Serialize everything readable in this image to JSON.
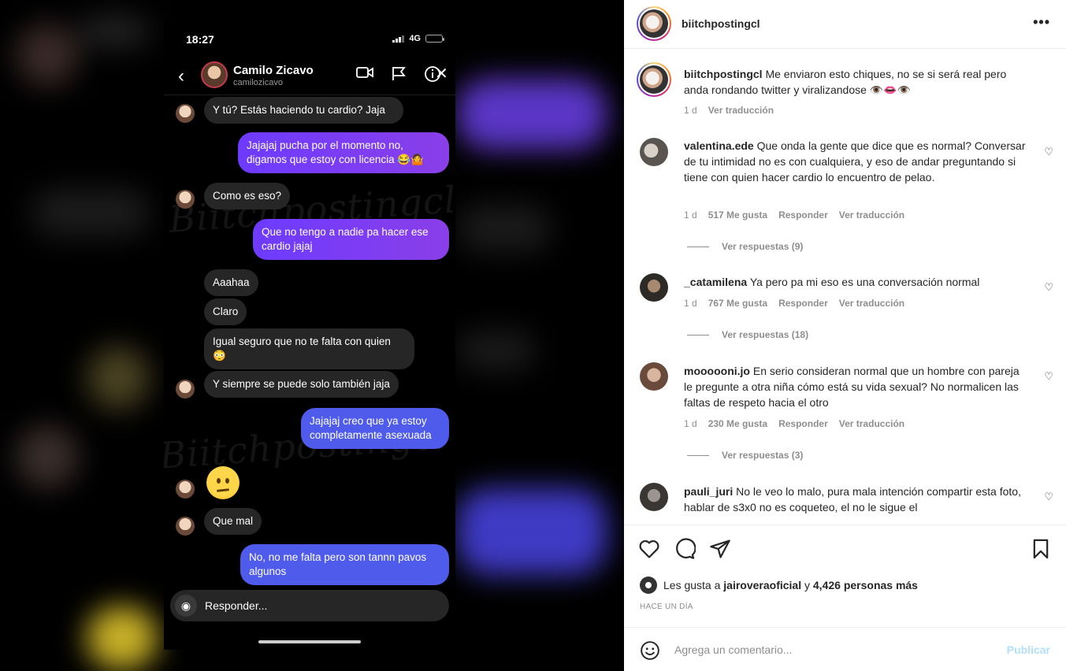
{
  "post": {
    "username": "biitchpostingcl",
    "more_icon": "more-horizontal-icon"
  },
  "screenshot": {
    "status_time": "18:27",
    "network": "4G",
    "contact_name": "Camilo Zicavo",
    "contact_handle": "camilozicavo",
    "watermark": "Biitchpostingcl",
    "messages": [
      {
        "dir": "in",
        "text": "Y tú? Estás haciendo tu cardio? Jaja"
      },
      {
        "dir": "out",
        "text": "Jajajaj pucha por el momento no, digamos que estoy con licencia 😂🤷"
      },
      {
        "dir": "in",
        "text": "Como es eso?"
      },
      {
        "dir": "out",
        "text": "Que no tengo a nadie pa hacer ese cardio jajaj"
      },
      {
        "dir": "in",
        "text": "Aaahaa"
      },
      {
        "dir": "in",
        "text": "Claro"
      },
      {
        "dir": "in",
        "text": "Igual seguro que no te falta con quien 😳"
      },
      {
        "dir": "in",
        "text": "Y siempre se puede solo también jaja"
      },
      {
        "dir": "out",
        "text": "Jajajaj creo que ya estoy completamente asexuada"
      },
      {
        "dir": "in",
        "text": "😕"
      },
      {
        "dir": "in",
        "text": "Que mal"
      },
      {
        "dir": "out",
        "text": "No, no me falta pero son tannn pavos algunos"
      }
    ],
    "composer_placeholder": "Responder..."
  },
  "caption": {
    "username": "biitchpostingcl",
    "text": "Me enviaron esto chiques, no se si será real pero anda rondando twitter y viralizandose 👁️👄👁️",
    "time": "1 d",
    "translate": "Ver traducción"
  },
  "comments": [
    {
      "username": "valentina.ede",
      "text": "Que onda la gente que dice que es normal? Conversar de tu intimidad no es con cualquiera, y eso de andar preguntando si tiene con quien hacer cardio lo encuentro de pelao.",
      "time": "1 d",
      "likes": "517 Me gusta",
      "reply": "Responder",
      "translate": "Ver traducción",
      "replies": "Ver respuestas (9)"
    },
    {
      "username": "_catamilena",
      "text": "Ya pero pa mi eso es una conversación normal",
      "time": "1 d",
      "likes": "767 Me gusta",
      "reply": "Responder",
      "translate": "Ver traducción",
      "replies": "Ver respuestas (18)"
    },
    {
      "username": "moooooni.jo",
      "text": "En serio consideran normal que un hombre con pareja le pregunte a otra niña cómo está su vida sexual? No normalicen las faltas de respeto hacia el otro",
      "time": "1 d",
      "likes": "230 Me gusta",
      "reply": "Responder",
      "translate": "Ver traducción",
      "replies": "Ver respuestas (3)"
    },
    {
      "username": "pauli_juri",
      "text": "No le veo lo malo, pura mala intención compartir esta foto, hablar de s3x0 no es coqueteo, el no le sigue el",
      "time": "",
      "likes": "",
      "reply": "",
      "translate": "",
      "replies": ""
    }
  ],
  "likes_line": {
    "prefix": "Les gusta a",
    "user": "jairoveraoficial",
    "connector": "y",
    "others": "4,426 personas más"
  },
  "time_ago": "HACE UN DÍA",
  "add_comment": {
    "placeholder": "Agrega un comentario...",
    "publish": "Publicar"
  },
  "colors": {
    "accent_purple": "#7a3dff",
    "link_disabled": "#b2dffc",
    "muted": "#8e8e8e"
  }
}
